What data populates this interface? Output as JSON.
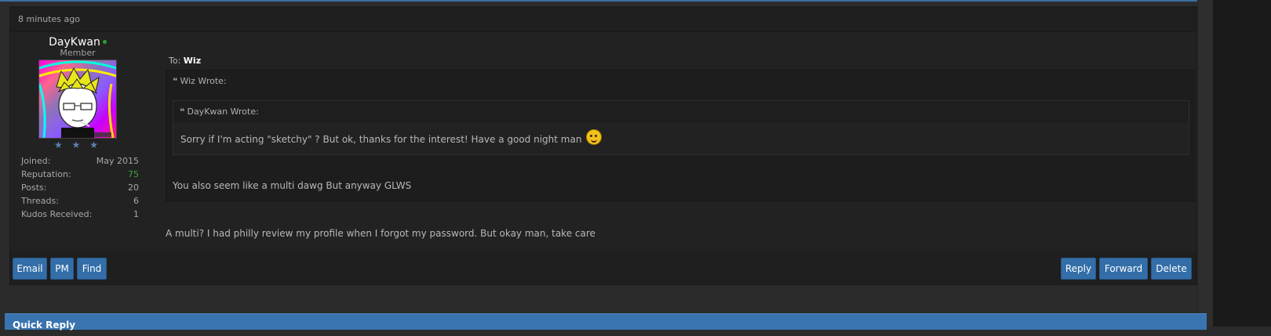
{
  "post": {
    "timestamp": "8 minutes ago",
    "author": {
      "username": "DayKwan",
      "title": "Member",
      "online": true,
      "stars": "★ ★ ★",
      "stats": [
        {
          "label": "Joined:",
          "value": "May 2015"
        },
        {
          "label": "Reputation:",
          "value": "75"
        },
        {
          "label": "Posts:",
          "value": "20"
        },
        {
          "label": "Threads:",
          "value": "6"
        },
        {
          "label": "Kudos Received:",
          "value": "1"
        }
      ]
    },
    "to_label": "To:",
    "to_name": "Wiz",
    "quote_outer": {
      "header": "Wiz Wrote:",
      "text": "You also seem like a multi dawg But anyway GLWS"
    },
    "quote_inner": {
      "header": "DayKwan Wrote:",
      "text": "Sorry if I'm acting \"sketchy\" ? But ok, thanks for the interest! Have a good night man"
    },
    "reply": "A multi? I had philly review my profile when I forgot my password. But okay man, take care"
  },
  "buttons_left": [
    "Email",
    "PM",
    "Find"
  ],
  "buttons_right": [
    "Reply",
    "Forward",
    "Delete"
  ],
  "quick_reply_label": "Quick Reply",
  "colors": {
    "accent": "#336ea8",
    "reputation": "#3fa33f",
    "background": "#2b2b2b"
  }
}
